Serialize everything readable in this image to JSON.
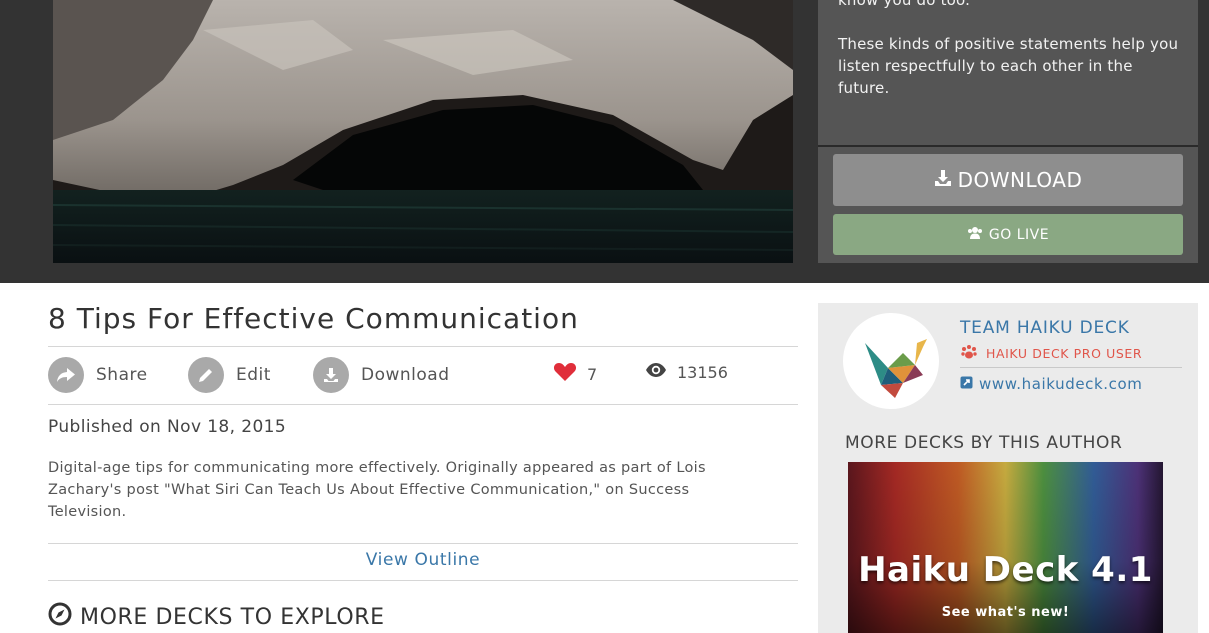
{
  "slide": {
    "notes_line1": "know you do too.",
    "notes_line2": "These kinds of positive statements help you listen respectfully to each other in the future.",
    "download_label": "DOWNLOAD",
    "golive_label": "GO LIVE"
  },
  "deck": {
    "title": "8 Tips For Effective Communication",
    "actions": {
      "share": "Share",
      "edit": "Edit",
      "download": "Download"
    },
    "likes": "7",
    "views": "13156",
    "published": "Published on Nov 18, 2015",
    "description": "Digital-age tips for communicating more effectively. Originally appeared as part of Lois Zachary's post \"What Siri Can Teach Us About Effective Communication,\" on Success Television.",
    "view_outline": "View Outline",
    "more_decks_heading": "MORE DECKS TO EXPLORE"
  },
  "author": {
    "name": "TEAM HAIKU DECK",
    "badge": "HAIKU DECK PRO USER",
    "link": "www.haikudeck.com",
    "more_by_heading": "MORE DECKS BY THIS AUTHOR",
    "thumb_title": "Haiku Deck 4.1",
    "thumb_subtitle": "See what's new!"
  },
  "icons": {
    "download": "download-icon",
    "golive": "users-icon",
    "share": "share-arrow-icon",
    "edit": "pencil-icon",
    "action_download": "download-icon",
    "likes": "heart-icon",
    "views": "eye-icon",
    "badge": "paw-icon",
    "link": "external-link-icon",
    "explore": "compass-icon"
  },
  "colors": {
    "link_blue": "#3a77a8",
    "heart_red": "#e02e3a",
    "pro_red": "#e0554a",
    "golive_green": "#8aa883",
    "download_gray": "#8e8e8e"
  }
}
